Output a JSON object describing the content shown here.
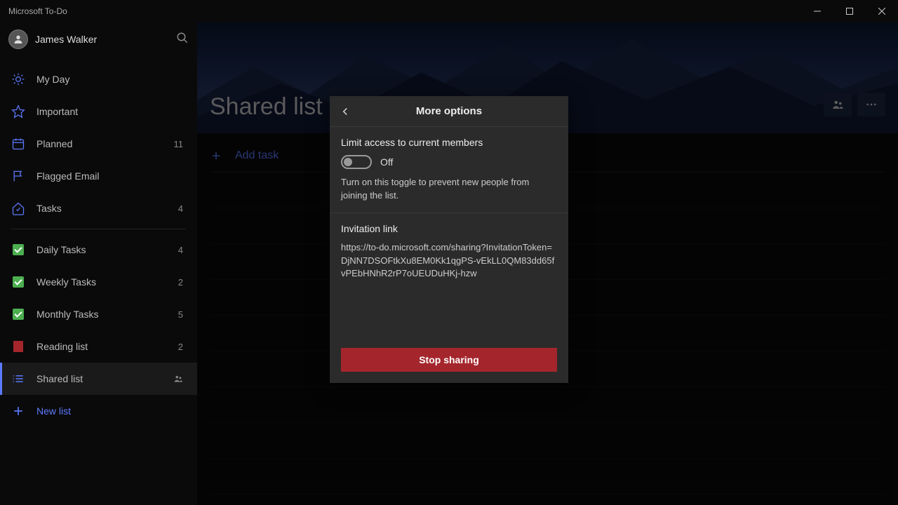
{
  "app_title": "Microsoft To-Do",
  "user": {
    "name": "James Walker"
  },
  "sidebar": {
    "items": [
      {
        "label": "My Day",
        "count": ""
      },
      {
        "label": "Important",
        "count": ""
      },
      {
        "label": "Planned",
        "count": "11"
      },
      {
        "label": "Flagged Email",
        "count": ""
      },
      {
        "label": "Tasks",
        "count": "4"
      }
    ],
    "custom_items": [
      {
        "label": "Daily Tasks",
        "count": "4"
      },
      {
        "label": "Weekly Tasks",
        "count": "2"
      },
      {
        "label": "Monthly Tasks",
        "count": "5"
      },
      {
        "label": "Reading list",
        "count": "2"
      },
      {
        "label": "Shared list",
        "count": ""
      }
    ],
    "new_list_label": "New list"
  },
  "main": {
    "title": "Shared list",
    "add_task_label": "Add task"
  },
  "modal": {
    "title": "More options",
    "limit_label": "Limit access to current members",
    "toggle_state": "Off",
    "limit_desc": "Turn on this toggle to prevent new people from joining the list.",
    "invitation_label": "Invitation link",
    "invitation_link": "https://to-do.microsoft.com/sharing?InvitationToken=DjNN7DSOFtkXu8EM0Kk1qgPS-vEkLL0QM83dd65fvPEbHNhR2rP7oUEUDuHKj-hzw",
    "stop_label": "Stop sharing"
  }
}
